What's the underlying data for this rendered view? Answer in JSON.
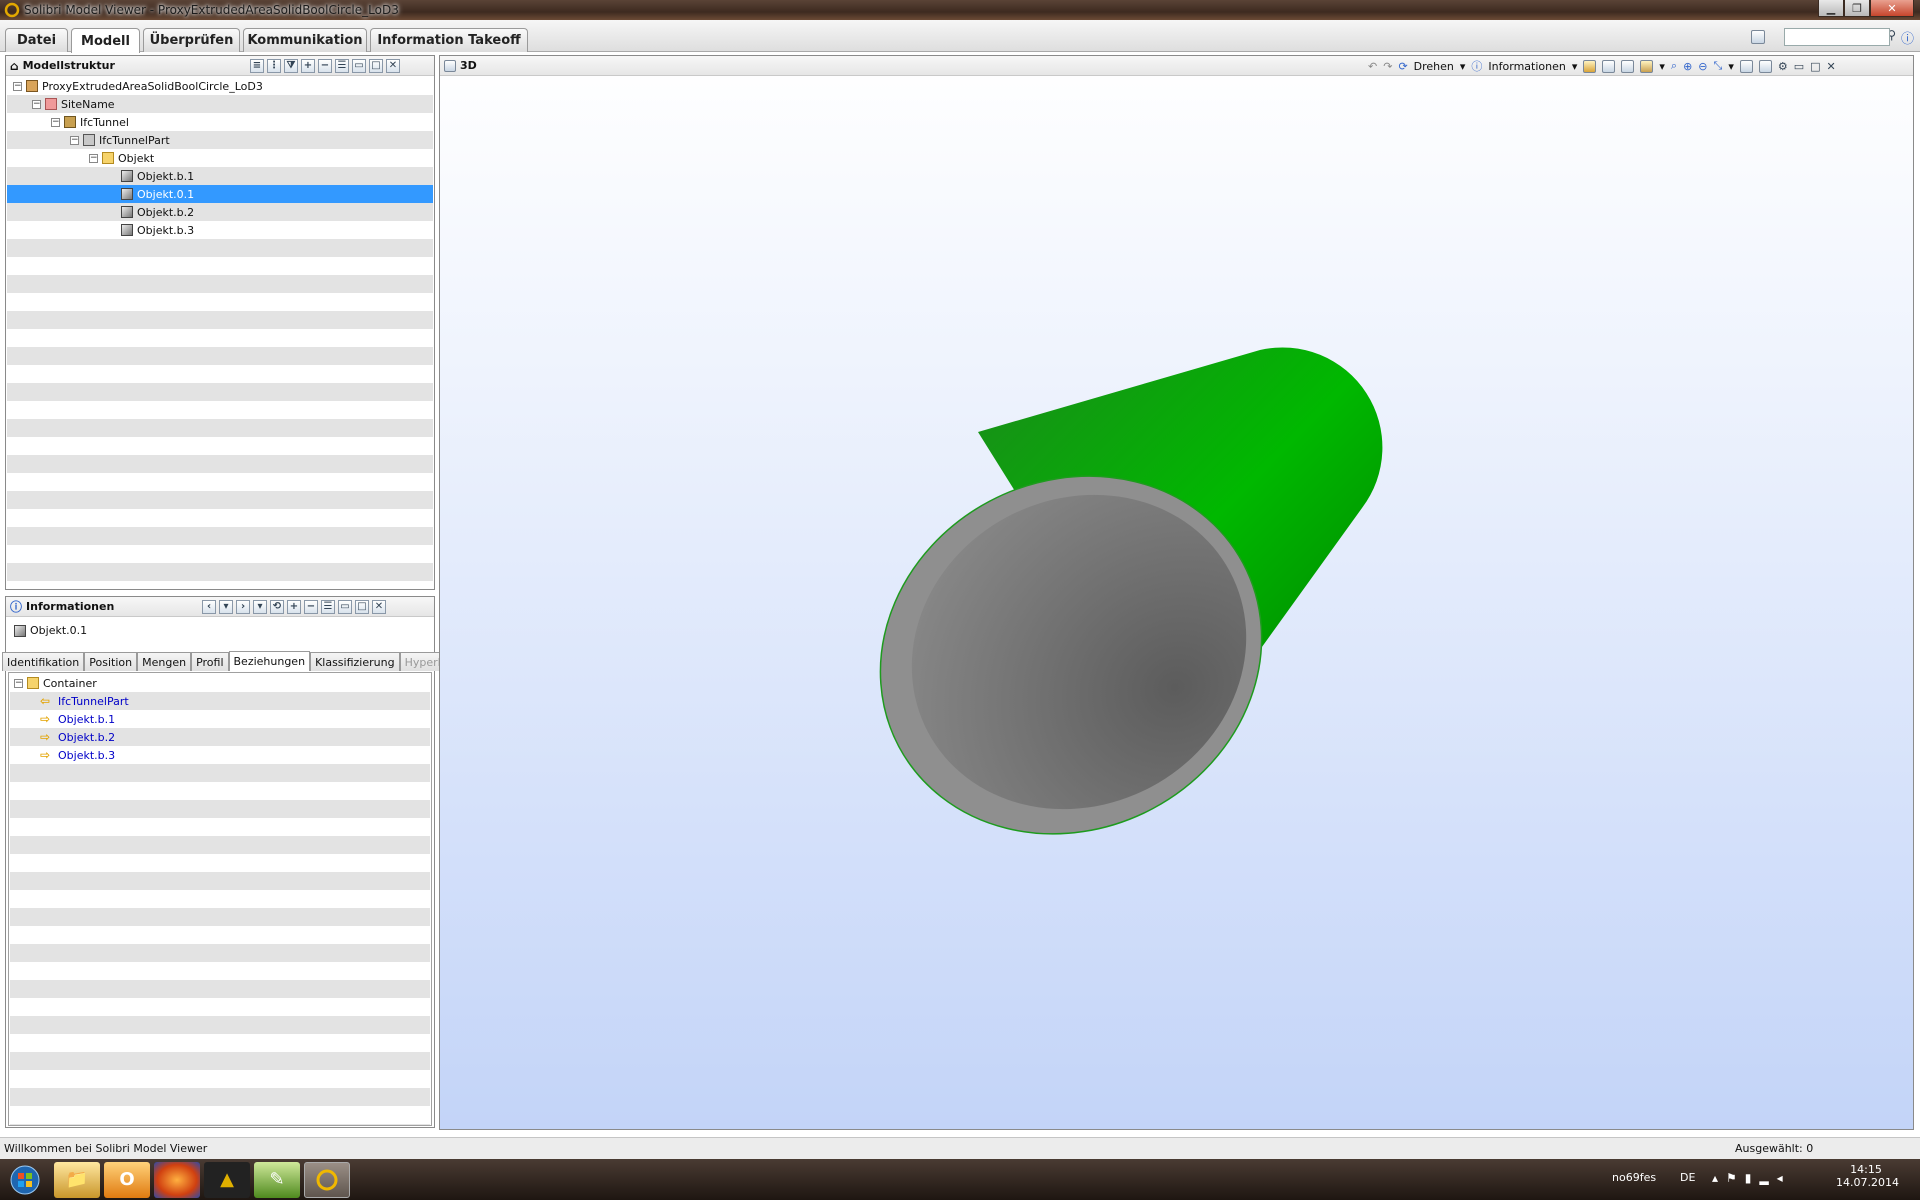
{
  "window": {
    "title": "Solibri Model Viewer - ProxyExtrudedAreaSolidBoolCircle_LoD3"
  },
  "menu": {
    "tabs": [
      "Datei",
      "Modell",
      "Überprüfen",
      "Kommunikation",
      "Information Takeoff"
    ],
    "active": "Modell"
  },
  "model_panel": {
    "title": "Modellstruktur",
    "tree": [
      {
        "label": "ProxyExtrudedAreaSolidBoolCircle_LoD3",
        "icon": "project-icon",
        "depth": 0,
        "expander": "−"
      },
      {
        "label": "SiteName",
        "icon": "site-icon",
        "depth": 1,
        "expander": "−"
      },
      {
        "label": "IfcTunnel",
        "icon": "building-icon",
        "depth": 2,
        "expander": "−"
      },
      {
        "label": "IfcTunnelPart",
        "icon": "storey-icon",
        "depth": 3,
        "expander": "−"
      },
      {
        "label": "Objekt",
        "icon": "folder-icon",
        "depth": 4,
        "expander": "−"
      },
      {
        "label": "Objekt.b.1",
        "icon": "object-icon",
        "depth": 5,
        "expander": ""
      },
      {
        "label": "Objekt.0.1",
        "icon": "object-icon",
        "depth": 5,
        "expander": "",
        "selected": true
      },
      {
        "label": "Objekt.b.2",
        "icon": "object-icon",
        "depth": 5,
        "expander": ""
      },
      {
        "label": "Objekt.b.3",
        "icon": "object-icon",
        "depth": 5,
        "expander": ""
      }
    ]
  },
  "info_panel": {
    "title": "Informationen",
    "selected_object": "Objekt.0.1",
    "tabs": [
      "Identifikation",
      "Position",
      "Mengen",
      "Profil",
      "Beziehungen",
      "Klassifizierung",
      "Hyperlinks"
    ],
    "active_tab": "Beziehungen",
    "disabled_tab": "Hyperlinks",
    "relations": [
      {
        "label": "Container",
        "kind": "folder"
      },
      {
        "label": "IfcTunnelPart",
        "kind": "parent"
      },
      {
        "label": "Objekt.b.1",
        "kind": "child"
      },
      {
        "label": "Objekt.b.2",
        "kind": "child"
      },
      {
        "label": "Objekt.b.3",
        "kind": "child"
      }
    ]
  },
  "view3d": {
    "title": "3D",
    "toolbar": {
      "rotate_label": "Drehen",
      "info_label": "Informationen"
    },
    "colors": {
      "tube_outer": "#00a800",
      "tube_face": "#8c8c8c",
      "tube_inner": "#6e6e6e"
    }
  },
  "status": {
    "message": "Willkommen bei Solibri Model Viewer",
    "selected": "Ausgewählt: 0"
  },
  "taskbar": {
    "apps": [
      "start-icon",
      "explorer-icon",
      "outlook-icon",
      "firefox-icon",
      "app-icon",
      "project-icon",
      "solibri-icon"
    ],
    "user": "no69fes",
    "lang": "DE",
    "time": "14:15",
    "date": "14.07.2014"
  }
}
